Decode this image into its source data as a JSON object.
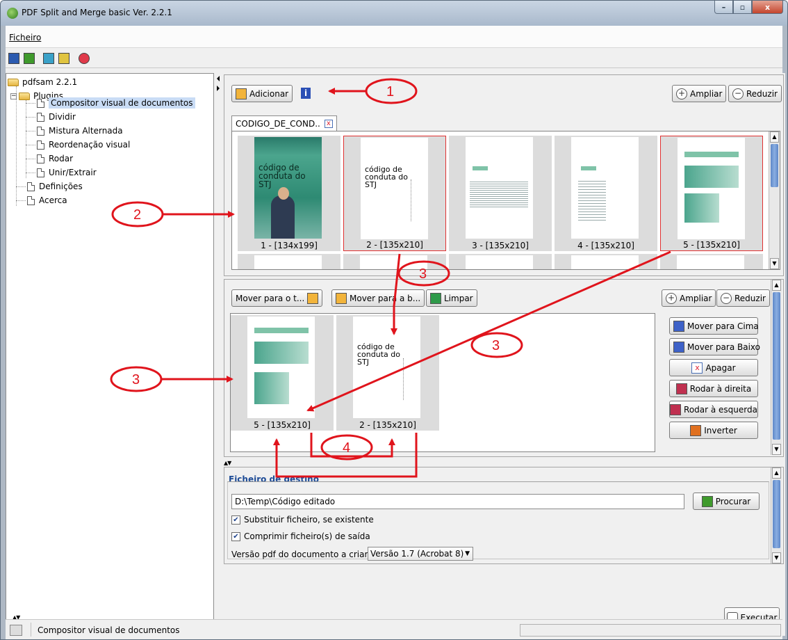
{
  "window": {
    "title": "PDF Split and Merge basic Ver. 2.2.1",
    "min": "–",
    "max": "▫",
    "close": "x"
  },
  "menu": {
    "ficheiro": "Ficheiro"
  },
  "tree": {
    "root": "pdfsam 2.2.1",
    "plugins": "Plugins",
    "items": [
      "Compositor visual de documentos",
      "Dividir",
      "Mistura Alternada",
      "Reordenação visual",
      "Rodar",
      "Unir/Extrair"
    ],
    "definicoes": "Definições",
    "acerca": "Acerca"
  },
  "top_panel": {
    "add_button": "Adicionar",
    "info_icon": "i",
    "zoom_in": "Ampliar",
    "zoom_out": "Reduzir",
    "tab_label": "CODIGO_DE_COND..",
    "tab_close": "x",
    "thumbs": [
      {
        "label": "1 - [134x199]",
        "cover_text": "código de conduta do STJ"
      },
      {
        "label": "2 - [135x210]",
        "cover_text": "código de conduta do STJ"
      },
      {
        "label": "3 - [135x210]"
      },
      {
        "label": "4 - [135x210]"
      },
      {
        "label": "5 - [135x210]"
      }
    ]
  },
  "middle_panel": {
    "move_top": "Mover para o t...",
    "move_bottom": "Mover para a b...",
    "clear": "Limpar",
    "zoom_in": "Ampliar",
    "zoom_out": "Reduzir",
    "thumbs": [
      {
        "label": "5 - [135x210]"
      },
      {
        "label": "2 - [135x210]",
        "cover_text": "código de conduta do STJ"
      }
    ],
    "side_buttons": [
      "Mover para Cima",
      "Mover para Baixo",
      "Apagar",
      "Rodar à direita",
      "Rodar à esquerda",
      "Inverter"
    ]
  },
  "destination": {
    "legend": "Ficheiro de destino",
    "path": "D:\\Temp\\Código editado",
    "browse": "Procurar",
    "overwrite": "Substituir ficheiro, se existente",
    "compress": "Comprimir ficheiro(s) de saída",
    "version_label": "Versão pdf do documento a criar:",
    "version_value": "Versão 1.7 (Acrobat 8)"
  },
  "run_button": "Executar",
  "status": {
    "text": "Compositor visual de documentos"
  },
  "annotations": [
    "1",
    "2",
    "3",
    "3",
    "3",
    "4"
  ],
  "colors": {
    "annotation": "#e0141c",
    "selection": "#c9dcf5",
    "scroll_thumb": "#6b93d0"
  }
}
